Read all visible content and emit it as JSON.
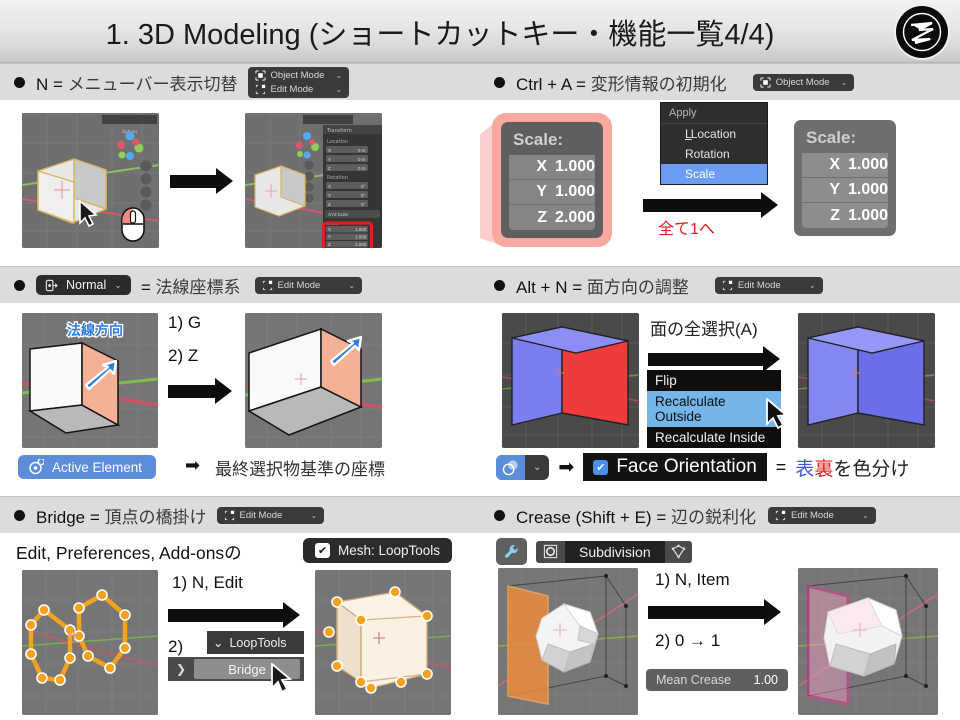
{
  "title": "1. 3D Modeling (ショートカットキー・機能一覧4/4)",
  "logo": {
    "name": "brand-logo"
  },
  "sections": [
    {
      "id": "n-menubar",
      "shortcut": "N",
      "equals": "=",
      "description": "メニューバー表示切替",
      "modes": [
        "Object Mode",
        "Edit Mode"
      ]
    },
    {
      "id": "ctrl-a-apply",
      "shortcut": "Ctrl + A",
      "equals": "=",
      "description": "変形情報の初期化",
      "modes": [
        "Object Mode"
      ],
      "scale_before": {
        "title": "Scale:",
        "rows": [
          [
            "X",
            "1.000"
          ],
          [
            "Y",
            "1.000"
          ],
          [
            "Z",
            "2.000"
          ]
        ]
      },
      "scale_after": {
        "title": "Scale:",
        "rows": [
          [
            "X",
            "1.000"
          ],
          [
            "Y",
            "1.000"
          ],
          [
            "Z",
            "1.000"
          ]
        ]
      },
      "apply_menu": {
        "header": "Apply",
        "items": [
          "Location",
          "Rotation",
          "Scale"
        ],
        "selected": "Scale"
      },
      "note": "全て1へ"
    },
    {
      "id": "normal-orientation",
      "pill": "Normal",
      "equals": "=",
      "description": "法線座標系",
      "modes": [
        "Edit Mode"
      ],
      "viewport_label": "法線方向",
      "steps": [
        "1) G",
        "2) Z"
      ],
      "footer_pill": "Active Element",
      "footer_arrow": "➡",
      "footer_text": "最終選択物基準の座標"
    },
    {
      "id": "alt-n-face-normals",
      "shortcut": "Alt + N",
      "equals": "=",
      "description": "面方向の調整",
      "modes": [
        "Edit Mode"
      ],
      "top_label": "面の全選択(A)",
      "menu": {
        "items": [
          "Flip",
          "Recalculate Outside",
          "Recalculate Inside"
        ],
        "selected": "Recalculate Outside"
      },
      "footer_overlay_icon": "overlay-icon",
      "footer_arrow": "➡",
      "footer_checkbox": "Face Orientation",
      "footer_equals": "=",
      "footer_text_a": "表",
      "footer_text_b": "裏",
      "footer_text_c": "を色分け"
    },
    {
      "id": "bridge-looptools",
      "shortcut": "Bridge",
      "equals": "=",
      "description": "頂点の橋掛け",
      "modes": [
        "Edit Mode"
      ],
      "prefs_text": "Edit, Preferences, Add-onsの",
      "addon_badge": "Mesh: LoopTools",
      "step1": "1) N, Edit",
      "step2": "2)",
      "panel_title": "LoopTools",
      "panel_button": "Bridge"
    },
    {
      "id": "crease",
      "shortcut": "Crease (Shift + E)",
      "equals": "=",
      "description": "辺の鋭利化",
      "modes": [
        "Edit Mode"
      ],
      "wrench_icon": "wrench-icon",
      "modifier_name": "Subdivision",
      "step1": "1) N, Item",
      "step2": "2) 0 → 1",
      "field_label": "Mean Crease",
      "field_value": "1.00"
    }
  ],
  "colors": {
    "header_bar": "#dcdcdc",
    "accent_blue": "#5b8dd9",
    "accent_red": "#e01b1b",
    "viewport_bg": "#707070",
    "dark_menu": "#2e2e2e"
  }
}
